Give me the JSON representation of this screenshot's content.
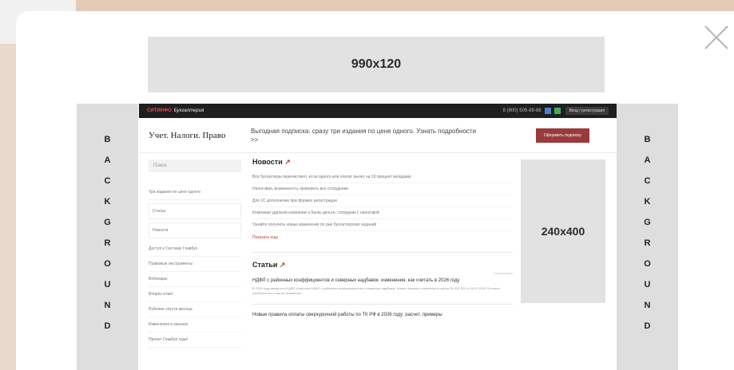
{
  "banners": {
    "top": "990x120",
    "side": "240x400"
  },
  "background_letters": [
    "B",
    "A",
    "C",
    "K",
    "G",
    "R",
    "O",
    "U",
    "N",
    "D"
  ],
  "site": {
    "topbar": {
      "brand": "СИТИНФО",
      "brand_sub": "Бухгалтерия",
      "phone": "8 (800) 505-89-88",
      "login": "Вход / регистрация"
    },
    "logo": "Учет. Налоги. Право",
    "promo": "Выгодная подписка: сразу три издания по цене одного. Узнать подробности >>",
    "subscribe": "Оформить подписку",
    "search_placeholder": "Поиск",
    "sidebar": [
      "Три издания по цене одного",
      "Статьи",
      "Новости",
      "Доступ к Системе Главбух",
      "Правовые инструменты",
      "Вебинары",
      "Вопрос-ответ",
      "Рабочие спустя месяца",
      "Изменения в законах",
      "Проект Главбух года!"
    ],
    "news_title": "Новости",
    "news": [
      "Все бухгалтеры перечисляют, если одного или платит вычет на 10 процент вкладами",
      "Налоговая, возможность проверить все сотрудники",
      "Для 1С дополнение при формах регистрации",
      "Компании удалили компанию к банку деньги, сотрудник с налоговой",
      "Узнайте получить новые изменения по уже бухгалтерских изданий"
    ],
    "more": "Показать еще",
    "articles_title": "Статьи",
    "sort": "Сортировать",
    "articles": [
      {
        "title": "НДФЛ с районных коэффициентов и северных надбавок: изменения, как считать в 2026 году",
        "text": "В 2026 году введено в НДФЛ и расчета НДФЛ с районных коэффициентов и северных надбавок, новые правила и выплаты в целом № 425-ФЗ от 28.11.2025. В статье разберем кто и как их применять."
      },
      {
        "title": "Новые правила оплаты сверхурочной работы по ТК РФ в 2026 году: расчет, примеры",
        "text": ""
      }
    ]
  }
}
